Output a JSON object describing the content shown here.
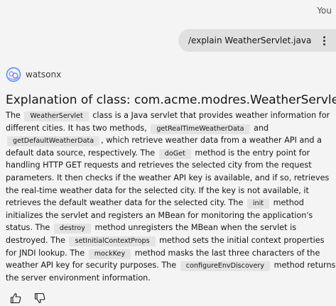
{
  "user": {
    "label": "You",
    "message": "/explain WeatherServlet.java"
  },
  "bot": {
    "name": "watsonx"
  },
  "response": {
    "title": "Explanation of class: com.acme.modres.WeatherServlet",
    "parts": [
      {
        "t": "text",
        "v": "The "
      },
      {
        "t": "code",
        "v": "WeatherServlet"
      },
      {
        "t": "text",
        "v": " class is a Java servlet that provides weather information for different cities. It has two methods, "
      },
      {
        "t": "code",
        "v": "getRealTimeWeatherData"
      },
      {
        "t": "text",
        "v": " and "
      },
      {
        "t": "code",
        "v": "getDefaultWeatherData"
      },
      {
        "t": "text",
        "v": ", which retrieve weather data from a weather API and a default data source, respectively. The "
      },
      {
        "t": "code",
        "v": "doGet"
      },
      {
        "t": "text",
        "v": " method is the entry point for handling HTTP GET requests and retrieves the selected city from the request parameters. It then checks if the weather API key is available, and if so, retrieves the real-time weather data for the selected city. If the key is not available, it retrieves the default weather data for the selected city. The "
      },
      {
        "t": "code",
        "v": "init"
      },
      {
        "t": "text",
        "v": " method initializes the servlet and registers an MBean for monitoring the application's status. The "
      },
      {
        "t": "code",
        "v": "destroy"
      },
      {
        "t": "text",
        "v": " method unregisters the MBean when the servlet is destroyed. The "
      },
      {
        "t": "code",
        "v": "setInitialContextProps"
      },
      {
        "t": "text",
        "v": " method sets the initial context properties for JNDI lookup. The "
      },
      {
        "t": "code",
        "v": "mockKey"
      },
      {
        "t": "text",
        "v": " method masks the last three characters of the weather API key for security purposes. The "
      },
      {
        "t": "code",
        "v": "configureEnvDiscovery"
      },
      {
        "t": "text",
        "v": " method returns the server environment information."
      }
    ]
  },
  "icons": {
    "overflow": "overflow-menu-icon",
    "avatar": "watsonx-avatar-icon",
    "thumbs_up": "thumbs-up-icon",
    "thumbs_down": "thumbs-down-icon"
  },
  "colors": {
    "avatar_blue": "#4589ff",
    "avatar_purple": "#a56eff"
  }
}
